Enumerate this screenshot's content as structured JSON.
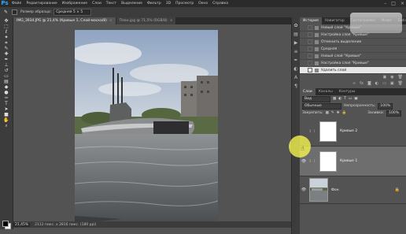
{
  "menubar": {
    "logo": "Ps",
    "items": [
      "Файл",
      "Редактирование",
      "Изображение",
      "Слои",
      "Текст",
      "Выделение",
      "Фильтр",
      "3D",
      "Просмотр",
      "Окно",
      "Справка"
    ]
  },
  "options": {
    "sample_label": "Размер образца:",
    "sample_value": "Средняя 5 × 5"
  },
  "doc_tabs": [
    {
      "label": "IMG_3934.JPG @ 21,4% (Кривые 1, Слой-маска/8)",
      "close": "×"
    },
    {
      "label": "План.jpg @ 71,5% (RGB/8)",
      "close": "×"
    }
  ],
  "status": {
    "zoom": "21,45%",
    "doc": "2112 пикс. x 2816 пикс. (180 ppi)"
  },
  "history": {
    "tabs": [
      "История",
      "Навигатор",
      "Гистограмма",
      "Инфо",
      "Библиотеки"
    ],
    "items": [
      {
        "label": "Новый слой \"Кривые\"",
        "active": false
      },
      {
        "label": "Настройка слоя \"Кривые\"",
        "active": false
      },
      {
        "label": "Отменить выделение",
        "active": false
      },
      {
        "label": "Средняя",
        "active": false
      },
      {
        "label": "Новый слой \"Кривые\"",
        "active": false
      },
      {
        "label": "Настройка слоя \"Кривые\"",
        "active": false
      },
      {
        "label": "Удалить слой",
        "active": true
      }
    ]
  },
  "layers": {
    "tabs": [
      "Слои",
      "Каналы",
      "Контуры"
    ],
    "kind": "Вид",
    "blend_mode": "Обычные",
    "opacity_label": "Непрозрачность:",
    "opacity": "100%",
    "lock_label": "Закрепить:",
    "fill_label": "Заливка:",
    "fill": "100%",
    "items": [
      {
        "name": "Кривые 2",
        "selected": false,
        "adjustment": true
      },
      {
        "name": "Кривые 1",
        "selected": true,
        "adjustment": true
      },
      {
        "name": "Фон",
        "selected": false,
        "adjustment": false
      }
    ]
  },
  "tools": [
    "move",
    "marquee",
    "lasso",
    "quick-select",
    "crop",
    "eyedropper",
    "healing",
    "brush",
    "stamp",
    "history-brush",
    "eraser",
    "gradient",
    "blur",
    "dodge",
    "pen",
    "type",
    "path-select",
    "shape",
    "hand",
    "zoom"
  ]
}
